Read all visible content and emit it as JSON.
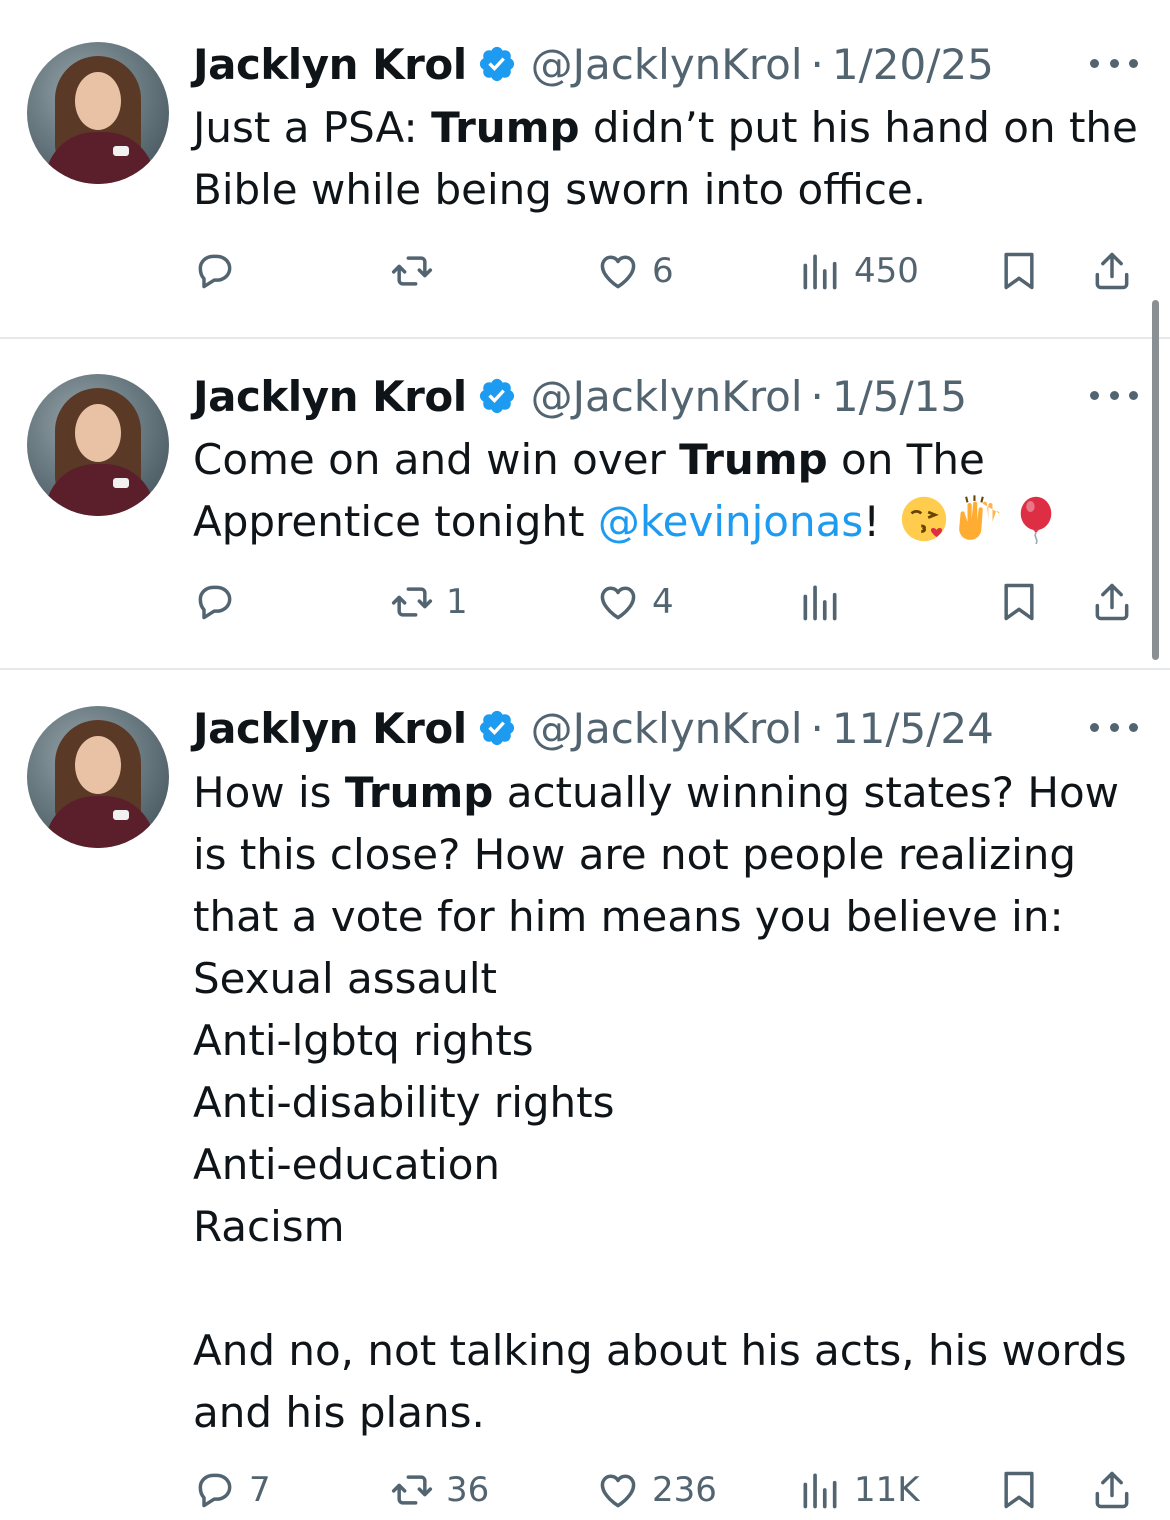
{
  "tweets": [
    {
      "name": "Jacklyn Krol",
      "handle": "@JacklynKrol",
      "date": "1/20/25",
      "text_segments": [
        {
          "t": "Just a PSA: "
        },
        {
          "t": "Trump",
          "bold": true
        },
        {
          "t": " didn’t put his hand on the Bible while being sworn into office."
        }
      ],
      "replies": "",
      "retweets": "",
      "likes": "6",
      "views": "450"
    },
    {
      "name": "Jacklyn Krol",
      "handle": "@JacklynKrol",
      "date": "1/5/15",
      "text_segments": [
        {
          "t": "Come on and win over "
        },
        {
          "t": "Trump",
          "bold": true
        },
        {
          "t": " on The Apprentice tonight "
        },
        {
          "t": "@kevinjonas",
          "mention": true
        },
        {
          "t": "! "
        }
      ],
      "emojis": [
        "face-blowing-kiss",
        "raising-hands",
        "balloon"
      ],
      "replies": "",
      "retweets": "1",
      "likes": "4",
      "views": ""
    },
    {
      "name": "Jacklyn Krol",
      "handle": "@JacklynKrol",
      "date": "11/5/24",
      "text_segments": [
        {
          "t": "How is "
        },
        {
          "t": "Trump",
          "bold": true
        },
        {
          "t": " actually winning states? How is this close? How are not people realizing that a vote for him means you believe in:\nSexual assault\nAnti-lgbtq rights\nAnti-disability rights\nAnti-education\nRacism\n\nAnd no, not talking about his acts, his words and his plans."
        }
      ],
      "replies": "7",
      "retweets": "36",
      "likes": "236",
      "views": "11K"
    }
  ],
  "colors": {
    "text": "#0f1419",
    "muted": "#536471",
    "accent": "#1d9bf0",
    "divider": "#e6e9eb"
  }
}
